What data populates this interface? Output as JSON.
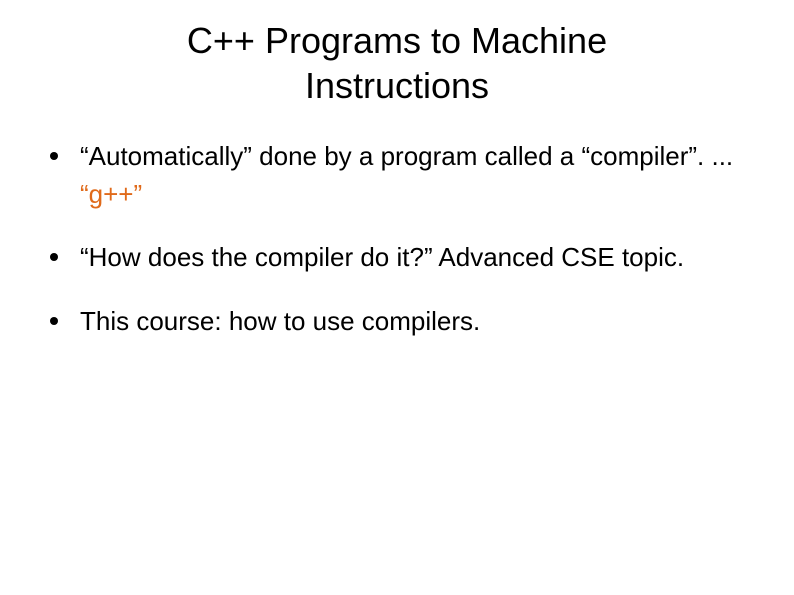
{
  "title": "C++ Programs to Machine Instructions",
  "bullets": [
    {
      "pre": "“Automatically” done by a program called a “compiler”.  ... ",
      "highlight": "“g++”",
      "post": ""
    },
    {
      "pre": "“How does the compiler do it?”  Advanced CSE topic.",
      "highlight": "",
      "post": ""
    },
    {
      "pre": "This course: how to use compilers.",
      "highlight": "",
      "post": ""
    }
  ]
}
